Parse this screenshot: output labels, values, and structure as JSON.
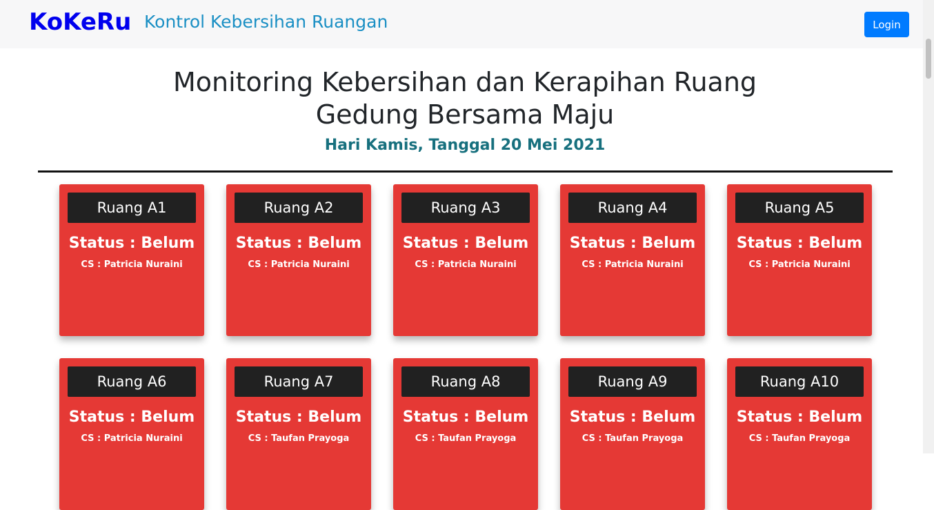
{
  "navbar": {
    "brand": "KoKeRu",
    "subtitle": "Kontrol Kebersihan Ruangan",
    "login_label": "Login"
  },
  "header": {
    "title_line1": "Monitoring Kebersihan dan Kerapihan Ruang",
    "title_line2": "Gedung Bersama Maju",
    "date": "Hari Kamis, Tanggal 20 Mei 2021"
  },
  "rooms": [
    {
      "name": "Ruang A1",
      "status": "Status : Belum",
      "cs": "CS : Patricia Nuraini"
    },
    {
      "name": "Ruang A2",
      "status": "Status : Belum",
      "cs": "CS : Patricia Nuraini"
    },
    {
      "name": "Ruang A3",
      "status": "Status : Belum",
      "cs": "CS : Patricia Nuraini"
    },
    {
      "name": "Ruang A4",
      "status": "Status : Belum",
      "cs": "CS : Patricia Nuraini"
    },
    {
      "name": "Ruang A5",
      "status": "Status : Belum",
      "cs": "CS : Patricia Nuraini"
    },
    {
      "name": "Ruang A6",
      "status": "Status : Belum",
      "cs": "CS : Patricia Nuraini"
    },
    {
      "name": "Ruang A7",
      "status": "Status : Belum",
      "cs": "CS : Taufan Prayoga"
    },
    {
      "name": "Ruang A8",
      "status": "Status : Belum",
      "cs": "CS : Taufan Prayoga"
    },
    {
      "name": "Ruang A9",
      "status": "Status : Belum",
      "cs": "CS : Taufan Prayoga"
    },
    {
      "name": "Ruang A10",
      "status": "Status : Belum",
      "cs": "CS : Taufan Prayoga"
    }
  ],
  "colors": {
    "brand": "#0000ee",
    "subtitle": "#1a8fc4",
    "login_button": "#007bff",
    "card": "#e53935",
    "room_label": "#212121",
    "date": "#17707e"
  }
}
